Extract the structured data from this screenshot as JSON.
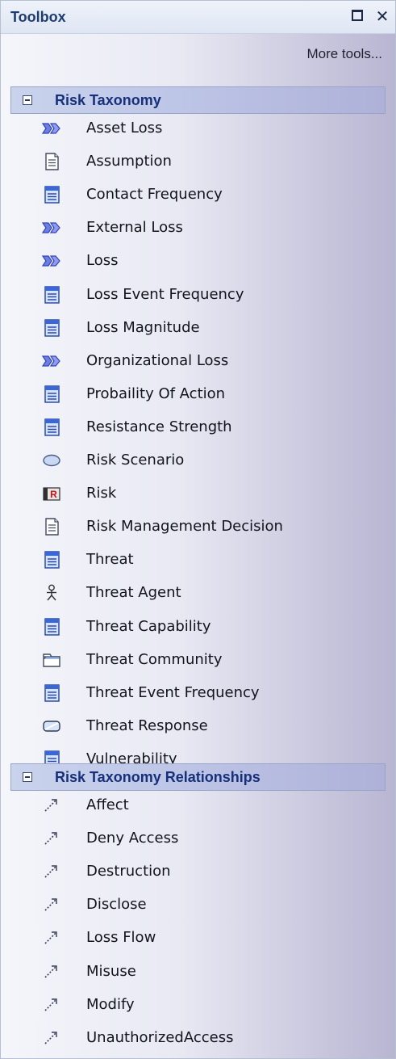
{
  "window": {
    "title": "Toolbox",
    "maximize_icon": "maximize-icon",
    "close_label": "✕"
  },
  "more_tools_label": "More tools...",
  "groups": [
    {
      "label": "Risk Taxonomy",
      "toggle_icon": "collapse-minus-icon",
      "items": [
        {
          "label": "Asset Loss",
          "icon": "flow-arrow-icon"
        },
        {
          "label": "Assumption",
          "icon": "document-icon"
        },
        {
          "label": "Contact Frequency",
          "icon": "class-list-icon"
        },
        {
          "label": "External Loss",
          "icon": "flow-arrow-icon"
        },
        {
          "label": "Loss",
          "icon": "flow-arrow-icon"
        },
        {
          "label": "Loss Event Frequency",
          "icon": "class-list-icon"
        },
        {
          "label": "Loss Magnitude",
          "icon": "class-list-icon"
        },
        {
          "label": "Organizational Loss",
          "icon": "flow-arrow-icon"
        },
        {
          "label": "Probaility Of Action",
          "icon": "class-list-icon"
        },
        {
          "label": "Resistance Strength",
          "icon": "class-list-icon"
        },
        {
          "label": "Risk Scenario",
          "icon": "ellipse-icon"
        },
        {
          "label": "Risk",
          "icon": "risk-r-icon"
        },
        {
          "label": "Risk Management Decision",
          "icon": "document-icon"
        },
        {
          "label": "Threat",
          "icon": "class-list-icon"
        },
        {
          "label": "Threat Agent",
          "icon": "actor-icon"
        },
        {
          "label": "Threat Capability",
          "icon": "class-list-icon"
        },
        {
          "label": "Threat Community",
          "icon": "package-folder-icon"
        },
        {
          "label": "Threat Event Frequency",
          "icon": "class-list-icon"
        },
        {
          "label": "Threat Response",
          "icon": "rounded-rect-icon"
        },
        {
          "label": "Vulnerability",
          "icon": "class-list-icon"
        }
      ]
    },
    {
      "label": "Risk Taxonomy Relationships",
      "toggle_icon": "collapse-minus-icon",
      "items": [
        {
          "label": "Affect",
          "icon": "dotted-connector-icon"
        },
        {
          "label": "Deny Access",
          "icon": "dotted-connector-icon"
        },
        {
          "label": "Destruction",
          "icon": "dotted-connector-icon"
        },
        {
          "label": "Disclose",
          "icon": "dotted-connector-icon"
        },
        {
          "label": "Loss Flow",
          "icon": "dotted-connector-icon"
        },
        {
          "label": "Misuse",
          "icon": "dotted-connector-icon"
        },
        {
          "label": "Modify",
          "icon": "dotted-connector-icon"
        },
        {
          "label": "UnauthorizedAccess",
          "icon": "dotted-connector-icon"
        }
      ]
    }
  ]
}
